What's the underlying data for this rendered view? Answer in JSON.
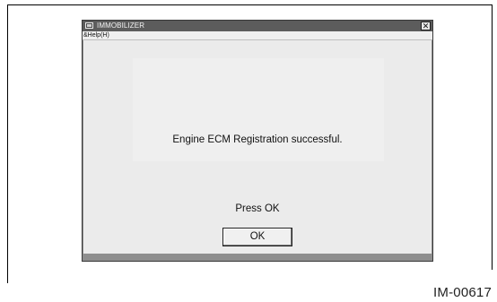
{
  "window": {
    "title": "IMMOBILIZER",
    "close_glyph": "✕",
    "menu": {
      "help_label": "&Help(H)"
    }
  },
  "dialog": {
    "message": "Engine ECM Registration successful.",
    "instruction": "Press OK",
    "ok_label": "OK"
  },
  "figure": {
    "id": "IM-00617"
  },
  "icons": {
    "app": "app-window-icon",
    "close": "close-icon"
  }
}
